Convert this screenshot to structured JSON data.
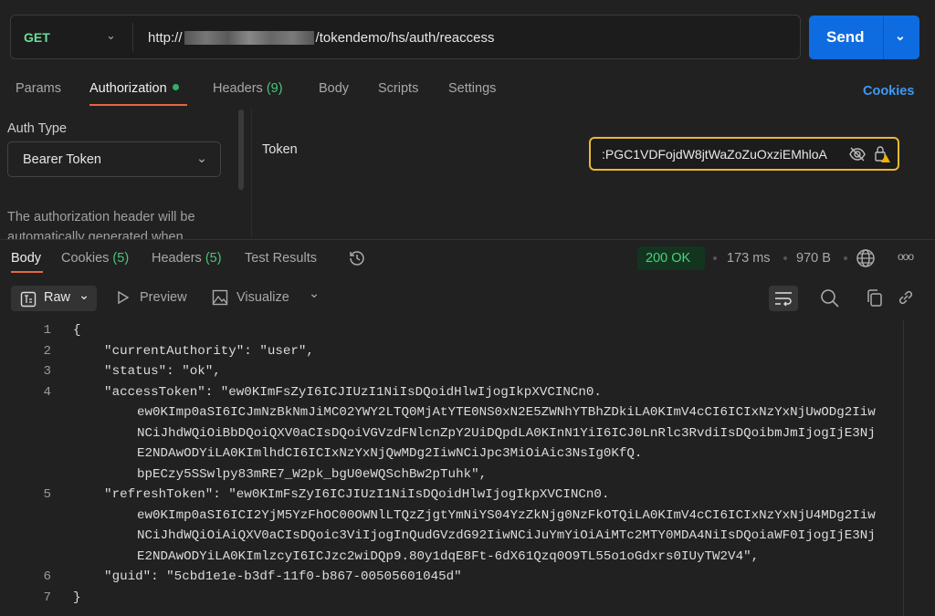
{
  "request": {
    "method": "GET",
    "url_prefix": "http://",
    "url_path": "/tokendemo/hs/auth/reaccess",
    "send_label": "Send"
  },
  "request_tabs": [
    {
      "label": "Params"
    },
    {
      "label": "Authorization"
    },
    {
      "label": "Headers",
      "count": "(9)"
    },
    {
      "label": "Body"
    },
    {
      "label": "Scripts"
    },
    {
      "label": "Settings"
    }
  ],
  "cookies_link": "Cookies",
  "auth": {
    "type_label": "Auth Type",
    "type_value": "Bearer Token",
    "description": "The authorization header will be automatically generated when",
    "token_label": "Token",
    "token_value": ":PGC1VDFojdW8jtWaZoZuOxziEMhloA"
  },
  "response_tabs": [
    {
      "label": "Body"
    },
    {
      "label": "Cookies",
      "count": "(5)"
    },
    {
      "label": "Headers",
      "count": "(5)"
    },
    {
      "label": "Test Results"
    }
  ],
  "response": {
    "status": "200 OK",
    "time": "173 ms",
    "size": "970 B"
  },
  "body_toolbar": {
    "format": "Raw",
    "preview": "Preview",
    "visualize": "Visualize"
  },
  "code_lines": [
    {
      "n": "1",
      "text": "{"
    },
    {
      "n": "2",
      "text": "    \"currentAuthority\": \"user\","
    },
    {
      "n": "3",
      "text": "    \"status\": \"ok\","
    },
    {
      "n": "4",
      "text": "    \"accessToken\": \"ew0KImFsZyI6ICJIUzI1NiIsDQoidHlwIjogIkpXVCINCn0.",
      "cont": [
        "ew0KImp0aSI6ICJmNzBkNmJiMC02YWY2LTQ0MjAtYTE0NS0xN2E5ZWNhYTBhZDkiLA0KImV4cCI6ICIxNzYxNjUwODg2Iiw",
        "NCiJhdWQiOiBbDQoiQXV0aCIsDQoiVGVzdFNlcnZpY2UiDQpdLA0KInN1YiI6ICJ0LnRlc3RvdiIsDQoibmJmIjogIjE3Nj",
        "E2NDAwODYiLA0KImlhdCI6ICIxNzYxNjQwMDg2IiwNCiJpc3MiOiAic3NsIg0KfQ.",
        "bpECzy5SSwlpy83mRE7_W2pk_bgU0eWQSchBw2pTuhk\","
      ]
    },
    {
      "n": "5",
      "text": "    \"refreshToken\": \"ew0KImFsZyI6ICJIUzI1NiIsDQoidHlwIjogIkpXVCINCn0.",
      "cont": [
        "ew0KImp0aSI6ICI2YjM5YzFhOC00OWNlLTQzZjgtYmNiYS04YzZkNjg0NzFkOTQiLA0KImV4cCI6ICIxNzYxNjU4MDg2Iiw",
        "NCiJhdWQiOiAiQXV0aCIsDQoic3ViIjogInQudGVzdG92IiwNCiJuYmYiOiAiMTc2MTY0MDA4NiIsDQoiaWF0IjogIjE3Nj",
        "E2NDAwODYiLA0KImlzcyI6ICJzc2wiDQp9.80y1dqE8Ft-6dX61Qzq0O9TL55o1oGdxrs0IUyTW2V4\","
      ]
    },
    {
      "n": "6",
      "text": "    \"guid\": \"5cbd1e1e-b3df-11f0-b867-00505601045d\""
    },
    {
      "n": "7",
      "text": "}"
    }
  ]
}
